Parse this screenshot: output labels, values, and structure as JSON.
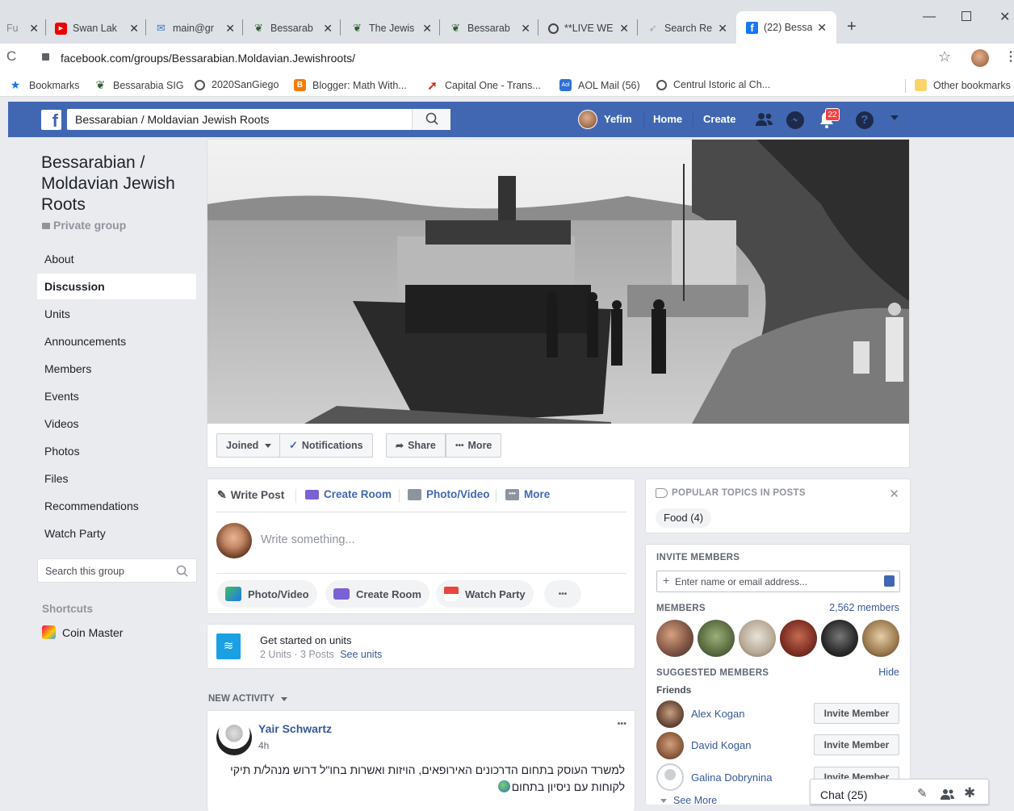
{
  "browser": {
    "tabs": [
      {
        "title": "Fu",
        "icon": "blank-icon"
      },
      {
        "title": "Swan Lak",
        "icon": "youtube-icon"
      },
      {
        "title": "main@gr",
        "icon": "mail-icon"
      },
      {
        "title": "Bessarab",
        "icon": "bessarabia-icon"
      },
      {
        "title": "The Jewis",
        "icon": "bessarabia-icon"
      },
      {
        "title": "Bessarab",
        "icon": "bessarabia-icon"
      },
      {
        "title": "**LIVE WE",
        "icon": "globe-icon"
      },
      {
        "title": "Search Re",
        "icon": "search-icon"
      },
      {
        "title": "(22) Bessa",
        "icon": "facebook-icon"
      }
    ],
    "url": "facebook.com/groups/Bessarabian.Moldavian.Jewishroots/",
    "bookmarks": [
      "Bookmarks",
      "Bessarabia SIG",
      "2020SanGiego",
      "Blogger: Math With...",
      "Capital One - Trans...",
      "AOL Mail (56)",
      "Centrul Istoric al Ch..."
    ],
    "other_bookmarks": "Other bookmarks"
  },
  "header": {
    "search_value": "Bessarabian / Moldavian Jewish Roots",
    "user_name": "Yefim",
    "home": "Home",
    "create": "Create",
    "notif_count": "22"
  },
  "group": {
    "title": "Bessarabian / Moldavian Jewish Roots",
    "privacy": "Private group",
    "nav": [
      "About",
      "Discussion",
      "Units",
      "Announcements",
      "Members",
      "Events",
      "Videos",
      "Photos",
      "Files",
      "Recommendations",
      "Watch Party"
    ],
    "search_placeholder": "Search this group",
    "shortcuts_label": "Shortcuts",
    "shortcut_item": "Coin Master"
  },
  "actions": {
    "joined": "Joined",
    "notifications": "Notifications",
    "share": "Share",
    "more": "More"
  },
  "composer": {
    "tabs": [
      "Write Post",
      "Create Room",
      "Photo/Video",
      "More"
    ],
    "placeholder": "Write something...",
    "buttons": [
      "Photo/Video",
      "Create Room",
      "Watch Party"
    ]
  },
  "units": {
    "title": "Get started on units",
    "meta": "2 Units · 3 Posts",
    "link": "See units"
  },
  "activity": {
    "label": "NEW ACTIVITY",
    "author": "Yair Schwartz",
    "time": "4h",
    "text_line1": "למשרד העוסק בתחום הדרכונים האירופאים, הויזות ואשרות בחו\"ל דרוש מנהל/ת תיקי",
    "text_line2": "לקוחות עם ניסיון בתחום"
  },
  "topics": {
    "label": "POPULAR TOPICS IN POSTS",
    "tag": "Food (4)"
  },
  "invite": {
    "label": "INVITE MEMBERS",
    "placeholder": "Enter name or email address...",
    "members_label": "MEMBERS",
    "members_count": "2,562 members",
    "suggested_label": "SUGGESTED MEMBERS",
    "hide": "Hide",
    "friends_label": "Friends",
    "people": [
      "Alex Kogan",
      "David Kogan",
      "Galina Dobrynina"
    ],
    "invite_btn": "Invite Member",
    "see_more": "See More"
  },
  "chat": {
    "label": "Chat (25)"
  }
}
